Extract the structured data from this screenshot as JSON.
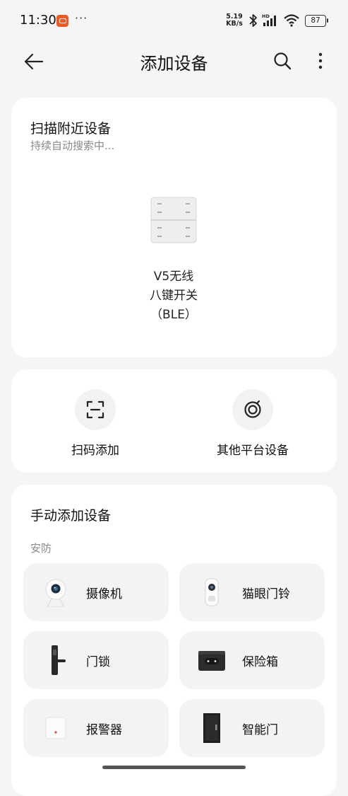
{
  "status_bar": {
    "time": "11:30",
    "dots": "···",
    "net_speed_value": "5.19",
    "net_speed_unit": "KB/s",
    "hd_label": "HD",
    "battery": "87"
  },
  "header": {
    "title": "添加设备",
    "icons": [
      "back-arrow-icon",
      "search-icon",
      "more-vertical-icon"
    ]
  },
  "nearby": {
    "title": "扫描附近设备",
    "subtitle": "持续自动搜索中...",
    "device_name": "V5无线\n八键开关\n（BLE）"
  },
  "actions": [
    {
      "label": "扫码添加",
      "icon": "scan-qr-icon"
    },
    {
      "label": "其他平台设备",
      "icon": "other-platform-icon"
    }
  ],
  "manual": {
    "title": "手动添加设备",
    "category": "安防",
    "devices": [
      {
        "label": "摄像机",
        "icon": "camera-icon"
      },
      {
        "label": "猫眼门铃",
        "icon": "peephole-doorbell-icon"
      },
      {
        "label": "门锁",
        "icon": "door-lock-icon"
      },
      {
        "label": "保险箱",
        "icon": "safe-box-icon"
      },
      {
        "label": "报警器",
        "icon": "alarm-icon"
      },
      {
        "label": "智能门",
        "icon": "smart-door-icon"
      }
    ]
  },
  "colors": {
    "background": "#f5f5f5",
    "card": "#ffffff",
    "tile": "#f3f3f3",
    "secondary_text": "#8a8a8a",
    "app_badge": "#f05a22"
  }
}
